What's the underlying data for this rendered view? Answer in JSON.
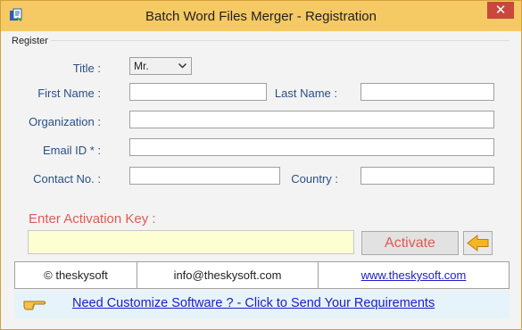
{
  "window": {
    "title": "Batch Word Files Merger - Registration",
    "close_glyph": "✕"
  },
  "register": {
    "legend": "Register",
    "title_label": "Title :",
    "title_value": "Mr.",
    "first_name_label": "First Name :",
    "first_name_value": "",
    "last_name_label": "Last Name :",
    "last_name_value": "",
    "organization_label": "Organization :",
    "organization_value": "",
    "email_label": "Email ID * :",
    "email_value": "",
    "contact_label": "Contact No. :",
    "contact_value": "",
    "country_label": "Country :",
    "country_value": ""
  },
  "activation": {
    "label": "Enter Activation Key  :",
    "key_value": "",
    "activate_button": "Activate"
  },
  "footer": {
    "copyright": "©  theskysoft",
    "email": "info@theskysoft.com",
    "website": "www.theskysoft.com"
  },
  "bottom": {
    "link_text": "Need Customize Software ? - Click to Send Your Requirements"
  },
  "icons": {
    "app": "word-merge-icon",
    "arrow": "left-arrow-icon",
    "hand": "pointing-hand-icon",
    "close": "close-icon"
  },
  "colors": {
    "titlebar": "#f5c963",
    "label": "#2a4f86",
    "accent": "#e05a55",
    "key_field": "#fdfed1",
    "link": "#1c1cc8",
    "bottom_bar": "#e6f3fa"
  }
}
